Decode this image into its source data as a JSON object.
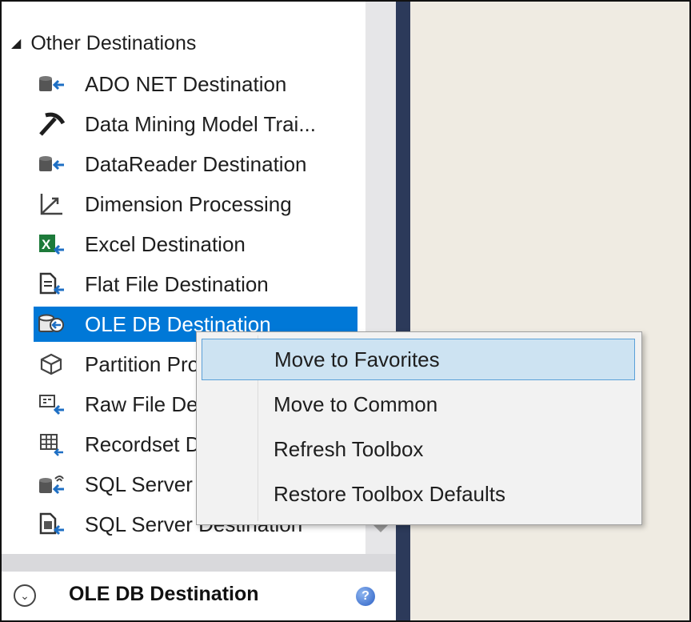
{
  "toolbox": {
    "group_header": "Other Destinations",
    "items": [
      {
        "label": "ADO NET Destination",
        "icon": "ado-net-destination-icon"
      },
      {
        "label": "Data Mining Model Trai...",
        "icon": "pickaxe-icon"
      },
      {
        "label": "DataReader Destination",
        "icon": "datareader-destination-icon"
      },
      {
        "label": "Dimension Processing",
        "icon": "dimension-axes-icon"
      },
      {
        "label": "Excel Destination",
        "icon": "excel-icon"
      },
      {
        "label": "Flat File Destination",
        "icon": "flat-file-icon"
      },
      {
        "label": "OLE DB Destination",
        "icon": "ole-db-icon",
        "selected": true
      },
      {
        "label": "Partition Processing",
        "icon": "cube-icon"
      },
      {
        "label": "Raw File Destination",
        "icon": "raw-file-icon"
      },
      {
        "label": "Recordset Destination",
        "icon": "grid-icon"
      },
      {
        "label": "SQL Server Compact Destination",
        "icon": "sql-compact-icon"
      },
      {
        "label": "SQL Server Destination",
        "icon": "sql-server-icon"
      }
    ]
  },
  "bottom_panel": {
    "title": "OLE DB Destination",
    "help_glyph": "?"
  },
  "context_menu": {
    "items": [
      {
        "label": "Move to Favorites",
        "highlighted": true
      },
      {
        "label": "Move to Common"
      },
      {
        "label": "Refresh Toolbox"
      },
      {
        "label": "Restore Toolbox Defaults"
      }
    ]
  },
  "colors": {
    "selection": "#0078d7",
    "menu_hover": "#cde3f2",
    "splitter": "#2c3a5a",
    "background": "#efebe2"
  }
}
